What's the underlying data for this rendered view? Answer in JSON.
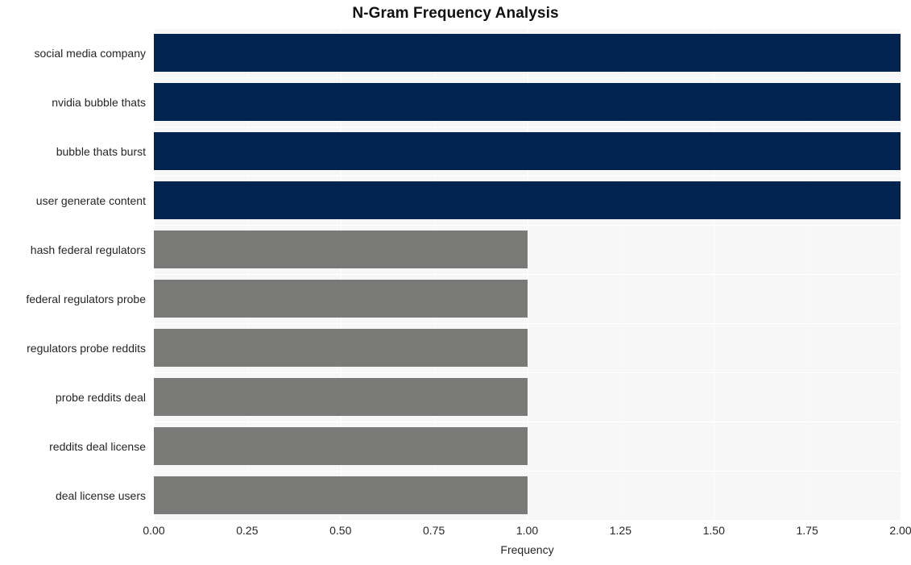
{
  "chart_data": {
    "type": "bar",
    "orientation": "horizontal",
    "title": "N-Gram Frequency Analysis",
    "xlabel": "Frequency",
    "ylabel": "",
    "categories": [
      "social media company",
      "nvidia bubble thats",
      "bubble thats burst",
      "user generate content",
      "hash federal regulators",
      "federal regulators probe",
      "regulators probe reddits",
      "probe reddits deal",
      "reddits deal license",
      "deal license users"
    ],
    "values": [
      2,
      2,
      2,
      2,
      1,
      1,
      1,
      1,
      1,
      1
    ],
    "bar_colors": [
      "#00234f",
      "#00234f",
      "#00234f",
      "#00234f",
      "#7a7a78",
      "#7a7a78",
      "#7a7a78",
      "#7a7a78",
      "#7a7a78",
      "#7a7a78"
    ],
    "xlim": [
      0,
      2
    ],
    "xticks": [
      0,
      0.25,
      0.5,
      0.75,
      1,
      1.25,
      1.5,
      1.75,
      2
    ],
    "xtick_labels": [
      "0.00",
      "0.25",
      "0.50",
      "0.75",
      "1.00",
      "1.25",
      "1.50",
      "1.75",
      "2.00"
    ],
    "grid": true,
    "legend": null,
    "plot_background": "#f7f7f7",
    "grid_color": "#ffffff",
    "figure_background": "#ffffff",
    "text_color": "#262626",
    "title_color": "#111111"
  }
}
